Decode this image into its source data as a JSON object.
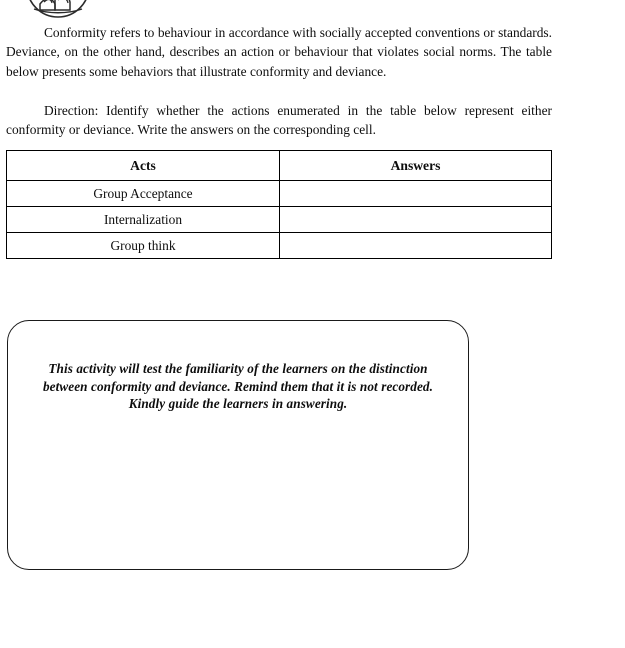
{
  "page": {
    "background_color": "#ffffff",
    "text_color": "#0d0d0d"
  },
  "decoration": {
    "top_clipped_illustration": "circular-line-drawing-clipped"
  },
  "body": {
    "paragraphs": [
      "Conformity refers to behaviour in accordance with socially accepted conventions or standards. Deviance, on the other hand, describes an action or behaviour that violates social norms. The table below presents some behaviors that illustrate conformity and deviance.",
      "Direction: Identify whether the actions enumerated in the table below represent either conformity or deviance. Write the answers on the corresponding cell."
    ]
  },
  "table": {
    "headers": [
      "Acts",
      "Answers"
    ],
    "rows": [
      {
        "act": "Group Acceptance",
        "answer": ""
      },
      {
        "act": "Internalization",
        "answer": ""
      },
      {
        "act": "Group think",
        "answer": ""
      }
    ]
  },
  "note_box": {
    "text": "This activity will test the familiarity of the learners on the distinction between conformity and deviance. Remind them that it is not recorded. Kindly guide the learners in answering."
  }
}
